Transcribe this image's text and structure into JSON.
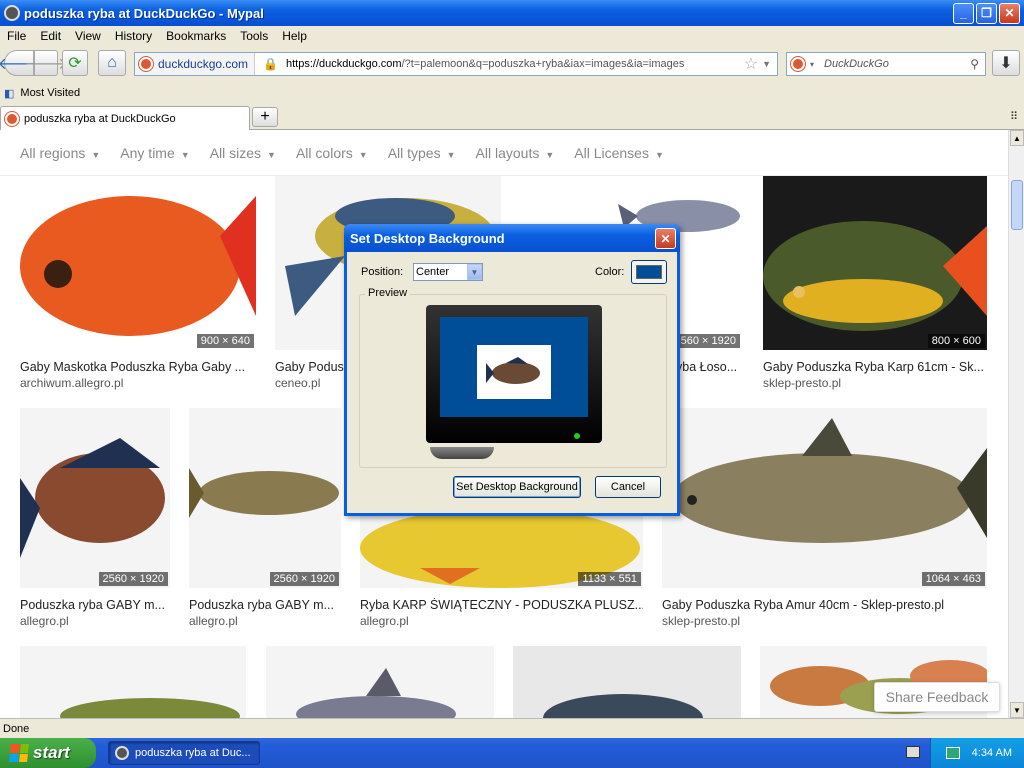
{
  "window": {
    "title": "poduszka ryba at DuckDuckGo - Mypal"
  },
  "menu": [
    "File",
    "Edit",
    "View",
    "History",
    "Bookmarks",
    "Tools",
    "Help"
  ],
  "nav": {
    "identity": "duckduckgo.com",
    "url_host": "https://duckduckgo.com",
    "url_path": "/?t=palemoon&q=poduszka+ryba&iax=images&ia=images",
    "search_placeholder": "DuckDuckGo"
  },
  "bookmarks": {
    "most_visited": "Most Visited"
  },
  "tabs": [
    {
      "label": "poduszka ryba at DuckDuckGo"
    }
  ],
  "filters": [
    "All regions",
    "Any time",
    "All sizes",
    "All colors",
    "All types",
    "All layouts",
    "All Licenses"
  ],
  "results": [
    {
      "title": "Gaby Maskotka Poduszka Ryba Gaby ...",
      "source": "archiwum.allegro.pl",
      "dims": "900 × 640",
      "color": "#e85a20"
    },
    {
      "title": "Gaby Podus",
      "source": "ceneo.pl",
      "dims": "",
      "color": "#3d5a80"
    },
    {
      "title": "yba Łoso...",
      "source": "",
      "dims": "2560 × 1920",
      "color": "#8a8fa8"
    },
    {
      "title": "Gaby Poduszka Ryba Karp 61cm - Sk...",
      "source": "sklep-presto.pl",
      "dims": "800 × 600",
      "color": "#4a5a2a"
    },
    {
      "title": "Poduszka ryba GABY m...",
      "source": "allegro.pl",
      "dims": "2560 × 1920",
      "color": "#8a4a30"
    },
    {
      "title": "Poduszka ryba GABY m...",
      "source": "allegro.pl",
      "dims": "2560 × 1920",
      "color": "#8a7a50"
    },
    {
      "title": "Ryba KARP ŚWIĄTECZNY - PODUSZKA PLUSZ...",
      "source": "allegro.pl",
      "dims": "1133 × 551",
      "color": "#e8c830"
    },
    {
      "title": "Gaby Poduszka Ryba Amur 40cm - Sklep-presto.pl",
      "source": "sklep-presto.pl",
      "dims": "1064 × 463",
      "color": "#8a8060"
    },
    {
      "title": "",
      "source": "",
      "dims": "",
      "color": "#7a8a3a"
    },
    {
      "title": "",
      "source": "",
      "dims": "",
      "color": "#5a5a6a"
    },
    {
      "title": "",
      "source": "",
      "dims": "",
      "color": "#3a4a5a"
    },
    {
      "title": "",
      "source": "",
      "dims": "",
      "color": "#c87a40"
    }
  ],
  "share_feedback": "Share Feedback",
  "status": "Done",
  "taskbar": {
    "start": "start",
    "item": "poduszka ryba at Duc...",
    "clock": "4:34 AM"
  },
  "dialog": {
    "title": "Set Desktop Background",
    "position_label": "Position:",
    "position_value": "Center",
    "color_label": "Color:",
    "color_value": "#004e98",
    "preview_label": "Preview",
    "set_button": "Set Desktop Background",
    "cancel_button": "Cancel"
  }
}
